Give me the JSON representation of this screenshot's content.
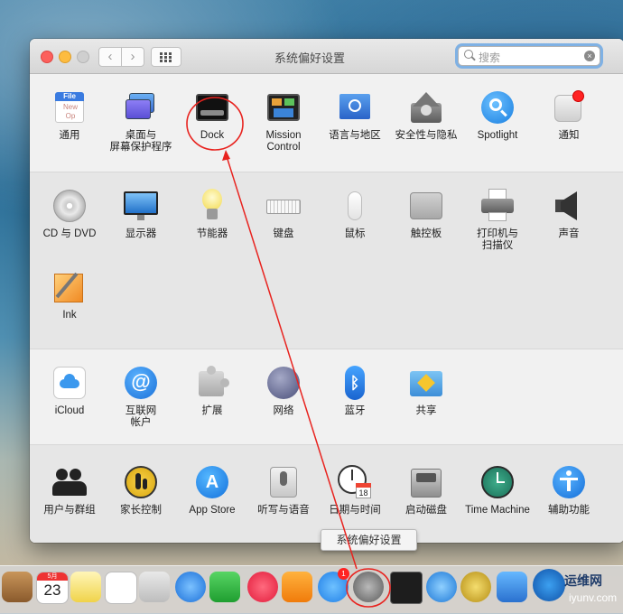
{
  "window": {
    "title": "系统偏好设置",
    "search_placeholder": "搜索",
    "nav_back": "‹",
    "nav_forward": "›"
  },
  "sections": [
    [
      {
        "label": "通用",
        "icon": "general-icon"
      },
      {
        "label": "桌面与\n屏幕保护程序",
        "icon": "desktop-screensaver-icon"
      },
      {
        "label": "Dock",
        "icon": "dock-icon"
      },
      {
        "label": "Mission\nControl",
        "icon": "mission-control-icon"
      },
      {
        "label": "语言与地区",
        "icon": "language-region-icon"
      },
      {
        "label": "安全性与隐私",
        "icon": "security-privacy-icon"
      },
      {
        "label": "Spotlight",
        "icon": "spotlight-icon"
      },
      {
        "label": "通知",
        "icon": "notifications-icon"
      }
    ],
    [
      {
        "label": "CD 与 DVD",
        "icon": "cd-dvd-icon"
      },
      {
        "label": "显示器",
        "icon": "displays-icon"
      },
      {
        "label": "节能器",
        "icon": "energy-saver-icon"
      },
      {
        "label": "键盘",
        "icon": "keyboard-icon"
      },
      {
        "label": "鼠标",
        "icon": "mouse-icon"
      },
      {
        "label": "触控板",
        "icon": "trackpad-icon"
      },
      {
        "label": "打印机与\n扫描仪",
        "icon": "printers-scanners-icon"
      },
      {
        "label": "声音",
        "icon": "sound-icon"
      },
      {
        "label": "Ink",
        "icon": "ink-icon"
      }
    ],
    [
      {
        "label": "iCloud",
        "icon": "icloud-icon"
      },
      {
        "label": "互联网\n帐户",
        "icon": "internet-accounts-icon"
      },
      {
        "label": "扩展",
        "icon": "extensions-icon"
      },
      {
        "label": "网络",
        "icon": "network-icon"
      },
      {
        "label": "蓝牙",
        "icon": "bluetooth-icon"
      },
      {
        "label": "共享",
        "icon": "sharing-icon"
      }
    ],
    [
      {
        "label": "用户与群组",
        "icon": "users-groups-icon"
      },
      {
        "label": "家长控制",
        "icon": "parental-controls-icon"
      },
      {
        "label": "App Store",
        "icon": "app-store-icon"
      },
      {
        "label": "听写与语音",
        "icon": "dictation-speech-icon"
      },
      {
        "label": "日期与时间",
        "icon": "date-time-icon"
      },
      {
        "label": "启动磁盘",
        "icon": "startup-disk-icon"
      },
      {
        "label": "Time Machine",
        "icon": "time-machine-icon"
      },
      {
        "label": "辅助功能",
        "icon": "accessibility-icon"
      }
    ]
  ],
  "icon_text": {
    "general_file": "File",
    "general_new": "New",
    "general_op": "Op",
    "calendar_month": "5月",
    "calendar_day": "23",
    "datetime_day": "18",
    "appstore_badge": "1"
  },
  "tooltip": "系统偏好设置",
  "watermark": {
    "title": "运维网",
    "sub": "iyunv.com"
  },
  "colors": {
    "annotation": "#e8231f",
    "accent": "#1a82fb"
  }
}
